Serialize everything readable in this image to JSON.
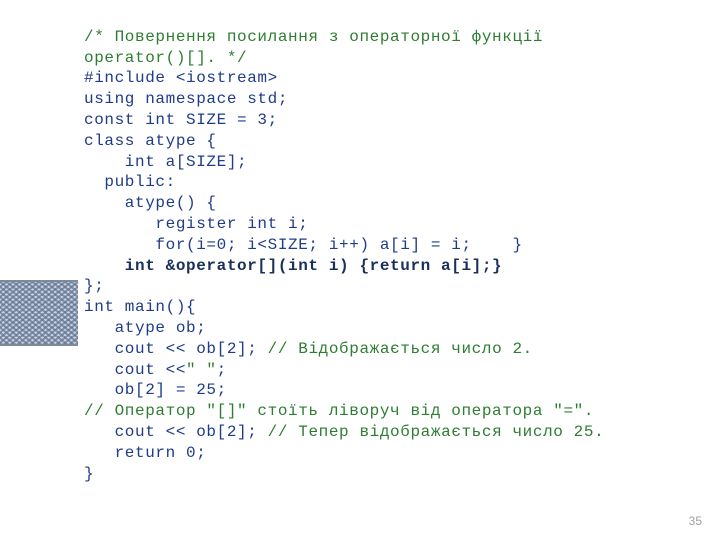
{
  "page_number": "35",
  "code": {
    "l01a": "/* Повернення посилання з операторної функції",
    "l01b": "operator()[]. */",
    "l02": "#include <iostream>",
    "l03": "using namespace std;",
    "l04": "const int SIZE = 3;",
    "l05": "class atype {",
    "l06": "    int a[SIZE];",
    "l07": "  public:",
    "l08": "    atype() {",
    "l09": "       register int i;",
    "l10": "       for(i=0; i<SIZE; i++) a[i] = i;    }",
    "l11": "    int &operator[](int i) {return a[i];}",
    "l12": "};",
    "l13": "int main(){",
    "l14": "   atype ob;",
    "l15a": "   cout << ob[2]; ",
    "l15b": "// Відображається число 2.",
    "l16a": "   cout <<",
    "l16b": "\" \"",
    "l16c": ";",
    "l17": "   ob[2] = 25;",
    "l18": "// Оператор \"[]\" стоїть ліворуч від оператора \"=\".",
    "l19a": "   cout << ob[2]; ",
    "l19b": "// Тепер відображається число 25.",
    "l20": "   return 0;",
    "l21": "}"
  }
}
